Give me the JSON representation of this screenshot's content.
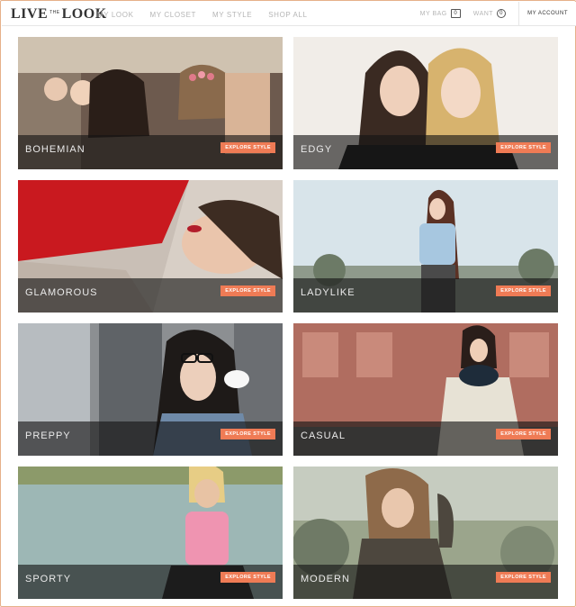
{
  "header": {
    "logo": {
      "left": "LIVE",
      "middle": "THE",
      "right": "LOOK"
    },
    "nav": [
      "MY LOOK",
      "MY CLOSET",
      "MY STYLE",
      "SHOP ALL"
    ],
    "bag": {
      "label": "MY BAG",
      "count": "0"
    },
    "wants": {
      "label": "WANT",
      "count": "0"
    },
    "account": "MY ACCOUNT"
  },
  "styles": [
    {
      "label": "BOHEMIAN",
      "cta": "EXPLORE STYLE"
    },
    {
      "label": "EDGY",
      "cta": "EXPLORE STYLE"
    },
    {
      "label": "GLAMOROUS",
      "cta": "EXPLORE STYLE"
    },
    {
      "label": "LADYLIKE",
      "cta": "EXPLORE STYLE"
    },
    {
      "label": "PREPPY",
      "cta": "EXPLORE STYLE"
    },
    {
      "label": "CASUAL",
      "cta": "EXPLORE STYLE"
    },
    {
      "label": "SPORTY",
      "cta": "EXPLORE STYLE"
    },
    {
      "label": "MODERN",
      "cta": "EXPLORE STYLE"
    }
  ],
  "colors": {
    "accent": "#ef7b55",
    "border": "#e6b089"
  }
}
